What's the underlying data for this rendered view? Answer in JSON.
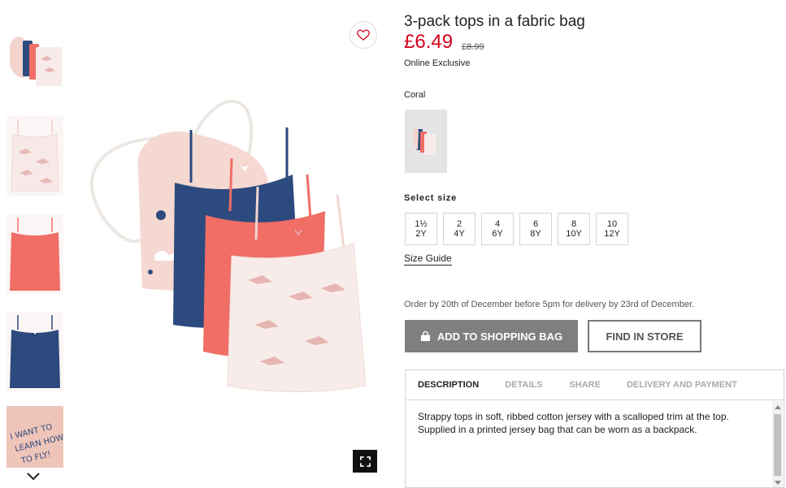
{
  "product": {
    "title": "3-pack tops in a fabric bag",
    "price": "£6.49",
    "old_price": "£8.99",
    "badge": "Online Exclusive",
    "color_label": "Coral",
    "size_label": "Select size",
    "sizes": [
      {
        "top": "1½",
        "bottom": "2Y"
      },
      {
        "top": "2",
        "bottom": "4Y"
      },
      {
        "top": "4",
        "bottom": "6Y"
      },
      {
        "top": "6",
        "bottom": "8Y"
      },
      {
        "top": "8",
        "bottom": "10Y"
      },
      {
        "top": "10",
        "bottom": "12Y"
      }
    ],
    "size_guide": "Size Guide",
    "order_note": "Order by 20th of December before 5pm for delivery by 23rd of December.",
    "add_to_bag": "ADD TO SHOPPING BAG",
    "find_in_store": "FIND IN STORE"
  },
  "tabs": [
    {
      "label": "DESCRIPTION",
      "active": true
    },
    {
      "label": "DETAILS",
      "active": false
    },
    {
      "label": "SHARE",
      "active": false
    },
    {
      "label": "DELIVERY AND PAYMENT",
      "active": false
    }
  ],
  "description": "Strappy tops in soft, ribbed cotton jersey with a scalloped trim at the top. Supplied in a printed jersey bag that can be worn as a backpack.",
  "thumbnails": {
    "items": [
      "pack-overview",
      "white-bird-top",
      "coral-top",
      "navy-top",
      "bag-print-closeup"
    ],
    "bag_print_text": "I WANT TO LEARN HOW TO FLY!"
  },
  "colors": {
    "price": "#d6001c",
    "navy": "#2d4a7e",
    "coral": "#f06e66",
    "blush": "#f2d4cc",
    "cream": "#f8ecea",
    "add_button_bg": "#7f7f7f"
  },
  "icons": [
    "heart-icon",
    "expand-icon",
    "chevron-down-icon",
    "bag-icon"
  ]
}
